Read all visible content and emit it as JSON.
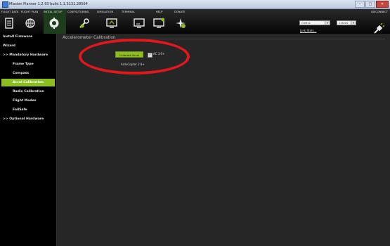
{
  "window": {
    "title": "Mission Planner 1.2.93 build 1.1.5131.28564",
    "min": "–",
    "max": "□",
    "close": "✕"
  },
  "toolbar": {
    "menus": [
      {
        "label": "FLIGHT DATA",
        "icon": "flight-data-icon"
      },
      {
        "label": "FLIGHT PLAN",
        "icon": "flight-plan-icon"
      },
      {
        "label": "INITIAL SETUP",
        "icon": "initial-setup-icon"
      },
      {
        "label": "CONFIG/TUNING",
        "icon": "config-tuning-icon"
      },
      {
        "label": "SIMULATION",
        "icon": "simulation-icon"
      },
      {
        "label": "TERMINAL",
        "icon": "terminal-icon"
      },
      {
        "label": "HELP",
        "icon": "help-icon"
      },
      {
        "label": "DONATE",
        "icon": "donate-icon"
      }
    ],
    "port": "COM12",
    "baud": "115200",
    "link_stats": "Link Stats...",
    "disconnect": "DISCONNECT"
  },
  "sidebar": {
    "items": [
      {
        "label": "Install Firmware"
      },
      {
        "label": "Wizard"
      },
      {
        "label": ">> Mandatory Hardware"
      },
      {
        "label": "Frame Type"
      },
      {
        "label": "Compass"
      },
      {
        "label": "Accel Calibration"
      },
      {
        "label": "Radio Calibration"
      },
      {
        "label": "Flight Modes"
      },
      {
        "label": "FailSafe"
      },
      {
        "label": ">> Optional Hardware"
      }
    ]
  },
  "main": {
    "title": "Accelerometer Calibration",
    "calibrate_button": "Calibrate Accel",
    "ac_checkbox_label": "AC 3.0+",
    "version_text": "ArduCopter 2.9+"
  },
  "colors": {
    "accent": "#8cc021",
    "highlight": "#e0171d"
  }
}
